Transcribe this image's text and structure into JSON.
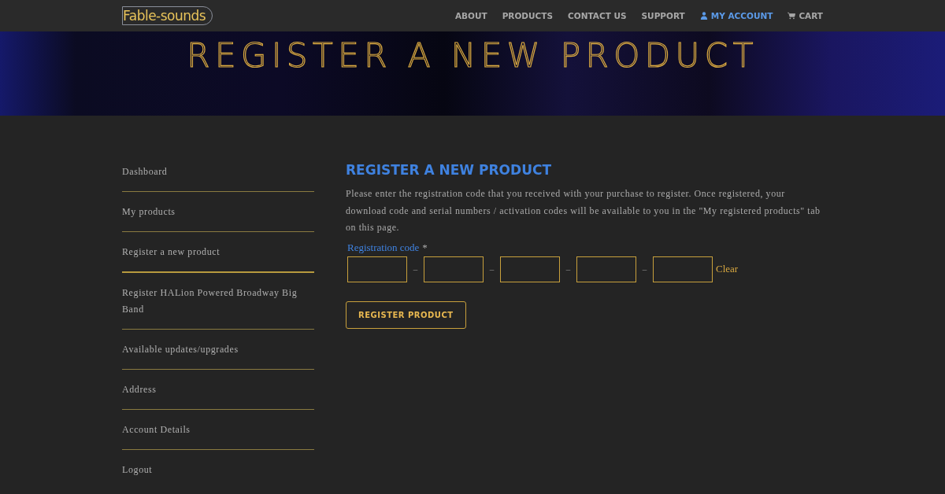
{
  "header": {
    "logo": "Fable-sounds",
    "nav": [
      {
        "label": "ABOUT",
        "selected": false,
        "kind": "page"
      },
      {
        "label": "PRODUCTS",
        "selected": false,
        "kind": "page"
      },
      {
        "label": "CONTACT US",
        "selected": false,
        "kind": "page"
      },
      {
        "label": "SUPPORT",
        "selected": false,
        "kind": "page"
      },
      {
        "label": "MY ACCOUNT",
        "selected": true,
        "kind": "account"
      },
      {
        "label": "CART",
        "selected": false,
        "kind": "cart"
      }
    ]
  },
  "banner": {
    "title": "REGISTER A NEW PRODUCT"
  },
  "sidebar": {
    "items": [
      {
        "label": "Dashboard",
        "selected": false
      },
      {
        "label": "My products",
        "selected": false
      },
      {
        "label": "Register a new product",
        "selected": true
      },
      {
        "label": "Register HALion Powered Broadway Big Band",
        "selected": false
      },
      {
        "label": "Available updates/upgrades",
        "selected": false
      },
      {
        "label": "Address",
        "selected": false
      },
      {
        "label": "Account Details",
        "selected": false
      },
      {
        "label": "Logout",
        "selected": false
      }
    ]
  },
  "main": {
    "heading": "REGISTER A NEW PRODUCT",
    "intro": "Please enter the registration code that you received with your purchase to register. Once registered, your download code and serial numbers / activation codes will be available to you in the \"My registered products\" tab on this page.",
    "field_label": "Registration code",
    "required_mark": "*",
    "code_separators": [
      "–",
      "–",
      "–",
      "–"
    ],
    "clear_link": "Clear",
    "submit_button": "REGISTER PRODUCT"
  }
}
